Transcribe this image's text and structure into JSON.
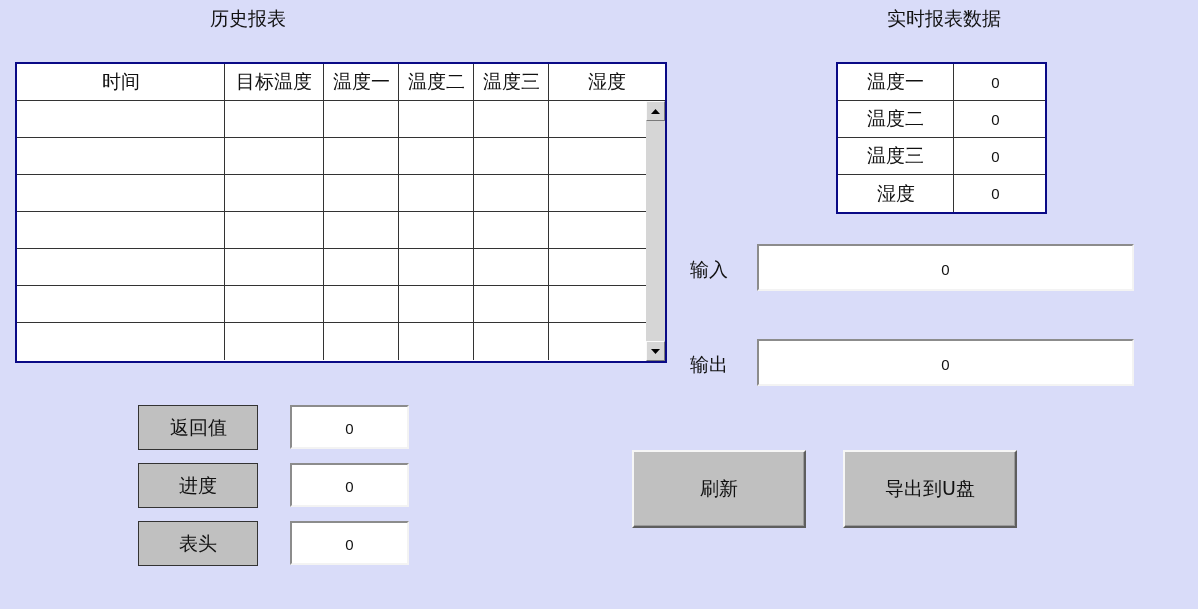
{
  "history_report": {
    "title": "历史报表",
    "table": {
      "columns": [
        "时间",
        "目标温度",
        "温度一",
        "温度二",
        "温度三",
        "湿度"
      ]
    }
  },
  "realtime_report": {
    "title": "实时报表数据",
    "rows": [
      {
        "label": "温度一",
        "value": "0"
      },
      {
        "label": "温度二",
        "value": "0"
      },
      {
        "label": "温度三",
        "value": "0"
      },
      {
        "label": "湿度",
        "value": "0"
      }
    ],
    "fields": [
      {
        "label": "输入",
        "value": "0"
      },
      {
        "label": "输出",
        "value": "0"
      }
    ]
  },
  "status_controls": [
    {
      "button": "返回值",
      "value": "0"
    },
    {
      "button": "进度",
      "value": "0"
    },
    {
      "button": "表头",
      "value": "0"
    }
  ],
  "action_buttons": [
    "刷新",
    "导出到U盘"
  ]
}
